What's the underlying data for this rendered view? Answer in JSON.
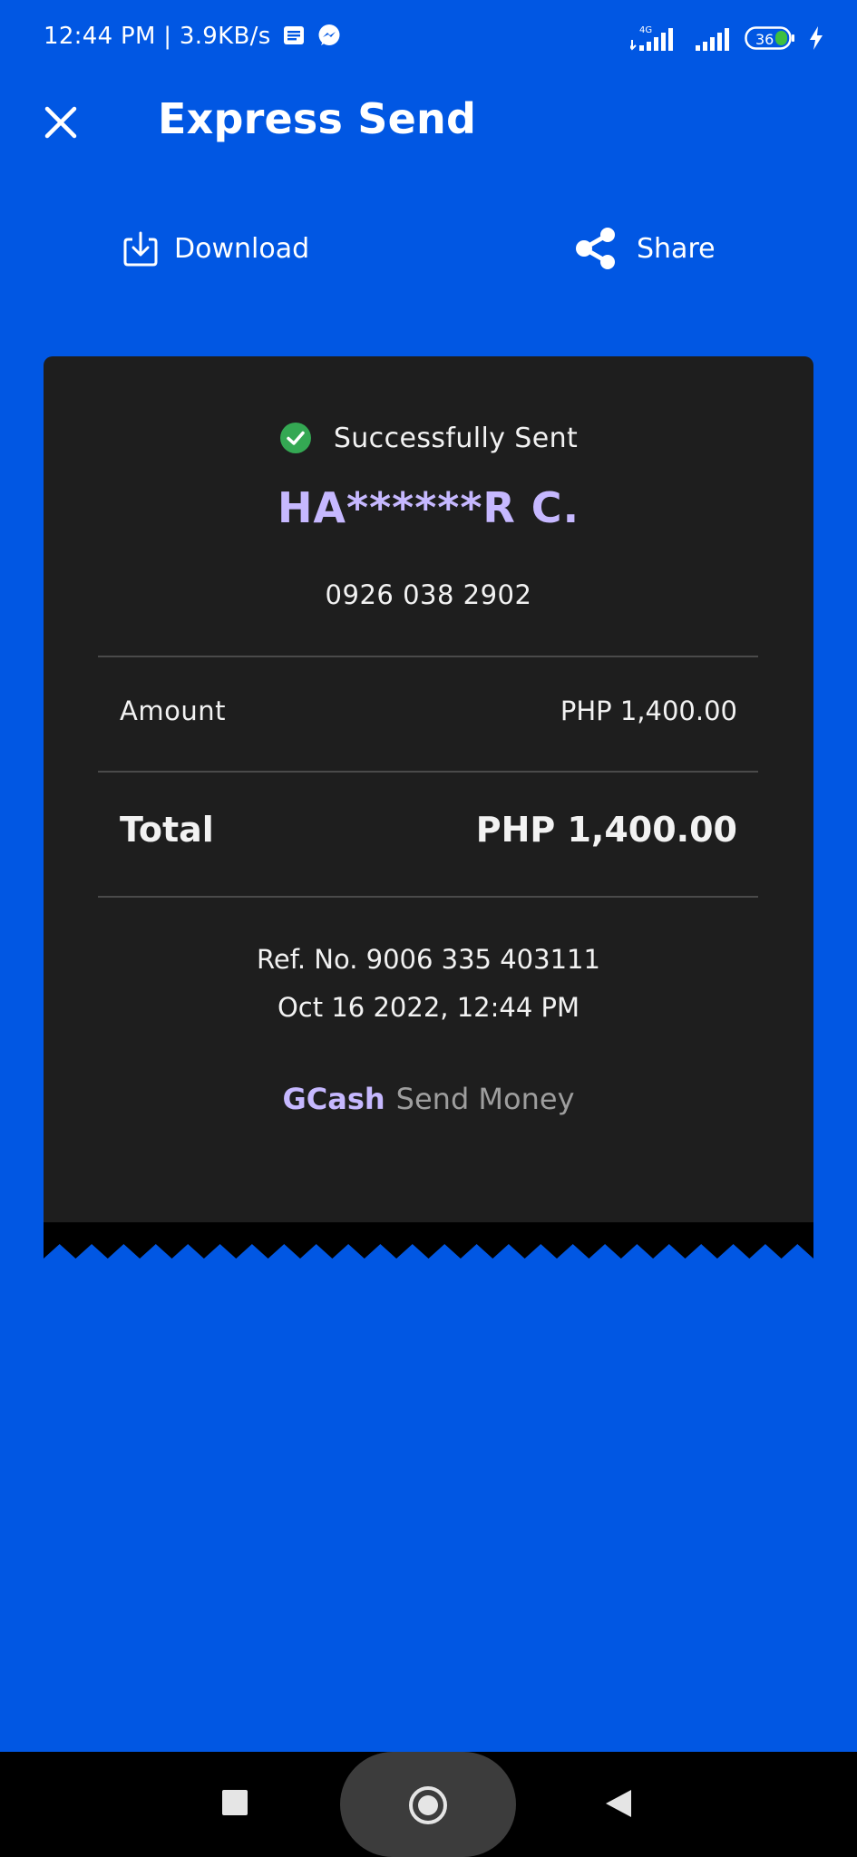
{
  "status_bar": {
    "time_speed": "12:44 PM | 3.9KB/s",
    "network_label": "4G",
    "battery_level": "36"
  },
  "header": {
    "title": "Express Send"
  },
  "actions": {
    "download_label": "Download",
    "share_label": "Share"
  },
  "receipt": {
    "status_text": "Successfully Sent",
    "recipient_name": "HA******R C.",
    "recipient_number": "0926 038 2902",
    "amount_label": "Amount",
    "amount_value": "PHP 1,400.00",
    "total_label": "Total",
    "total_value": "PHP 1,400.00",
    "ref_no": "Ref. No. 9006 335 403111",
    "datetime": "Oct 16 2022, 12:44 PM",
    "brand_name": "GCash",
    "brand_service": "Send Money"
  },
  "colors": {
    "background": "#0157e3",
    "card": "#1e1e1e",
    "accent": "#c6b8ff",
    "success": "#34a853"
  },
  "icons": {
    "close": "close-icon",
    "download": "download-icon",
    "share": "share-icon",
    "success": "check-circle-icon"
  }
}
